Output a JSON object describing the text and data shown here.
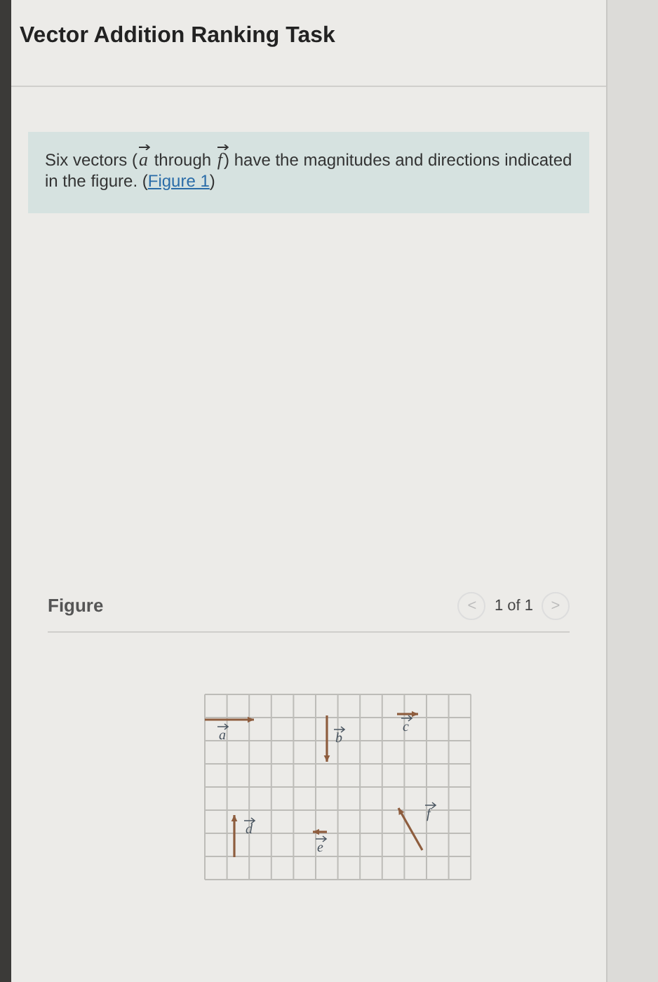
{
  "title": "Vector Addition Ranking Task",
  "question": {
    "parts": [
      {
        "kind": "text",
        "text": "Six vectors ("
      },
      {
        "kind": "vector",
        "text": "a"
      },
      {
        "kind": "text",
        "text": " through "
      },
      {
        "kind": "vector",
        "text": "f"
      },
      {
        "kind": "text",
        "text": ") have the magnitudes and directions indicated in the figure. ("
      },
      {
        "kind": "link",
        "text": "Figure 1"
      },
      {
        "kind": "text",
        "text": ")"
      }
    ]
  },
  "figure": {
    "heading": "Figure",
    "pager": "1 of 1",
    "prev": "<",
    "next": ">",
    "vectors": [
      {
        "label": "a"
      },
      {
        "label": "b"
      },
      {
        "label": "c"
      },
      {
        "label": "d"
      },
      {
        "label": "e"
      },
      {
        "label": "f"
      }
    ]
  }
}
